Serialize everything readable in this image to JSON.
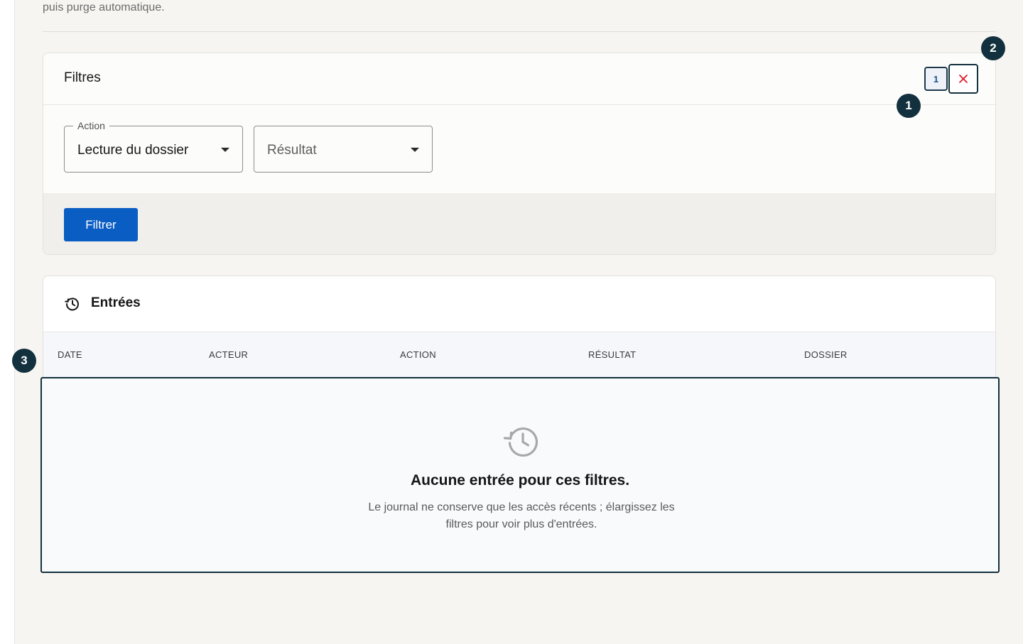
{
  "intro": {
    "text": "puis purge automatique."
  },
  "filters": {
    "title": "Filtres",
    "active_count": "1",
    "clear_icon": "close-icon",
    "action_select": {
      "legend": "Action",
      "value": "Lecture du dossier"
    },
    "result_select": {
      "placeholder": "Résultat"
    },
    "submit_label": "Filtrer"
  },
  "entries": {
    "title": "Entrées",
    "icon": "history-icon",
    "columns": [
      "DATE",
      "ACTEUR",
      "ACTION",
      "RÉSULTAT",
      "DOSSIER"
    ],
    "empty": {
      "title": "Aucune entrée pour ces filtres.",
      "description": "Le journal ne conserve que les accès récents ; élargissez les filtres pour voir plus d'entrées."
    }
  },
  "markers": [
    "1",
    "2",
    "3"
  ],
  "colors": {
    "primary": "#0a5dc2",
    "marker": "#13303e",
    "danger": "#da1e28"
  }
}
